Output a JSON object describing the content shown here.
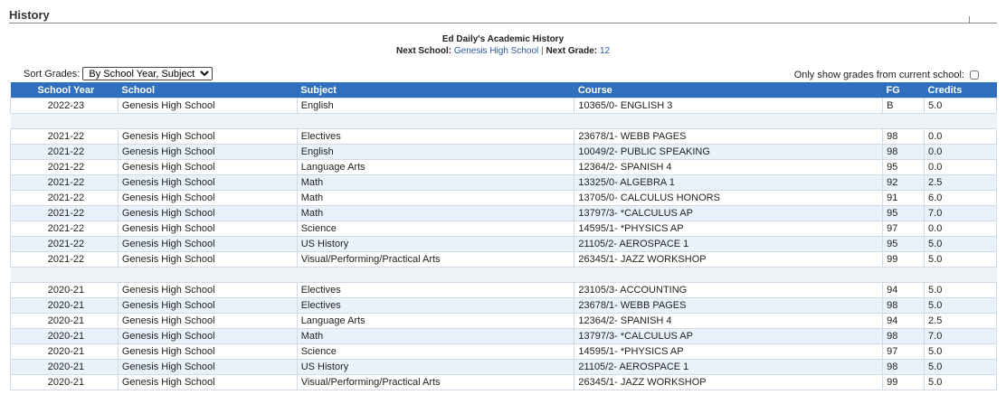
{
  "section": {
    "title": "History"
  },
  "header": {
    "student_history": "Ed Daily's Academic History",
    "next_school_label": "Next School:",
    "next_school_value": "Genesis High School",
    "separator": "|",
    "next_grade_label": "Next Grade:",
    "next_grade_value": "12"
  },
  "controls": {
    "sort_label": "Sort Grades:",
    "sort_selected": "By School Year, Subject",
    "only_current_label": "Only show grades from current school:"
  },
  "table": {
    "headers": [
      "School Year",
      "School",
      "Subject",
      "Course",
      "FG",
      "Credits"
    ],
    "groups": [
      [
        [
          "2022-23",
          "Genesis High School",
          "English",
          "10365/0- ENGLISH 3",
          "B",
          "5.0"
        ]
      ],
      [
        [
          "2021-22",
          "Genesis High School",
          "Electives",
          "23678/1- WEBB PAGES",
          "98",
          "0.0"
        ],
        [
          "2021-22",
          "Genesis High School",
          "English",
          "10049/2- PUBLIC SPEAKING",
          "98",
          "0.0"
        ],
        [
          "2021-22",
          "Genesis High School",
          "Language Arts",
          "12364/2- SPANISH 4",
          "95",
          "0.0"
        ],
        [
          "2021-22",
          "Genesis High School",
          "Math",
          "13325/0- ALGEBRA 1",
          "92",
          "2.5"
        ],
        [
          "2021-22",
          "Genesis High School",
          "Math",
          "13705/0- CALCULUS HONORS",
          "91",
          "6.0"
        ],
        [
          "2021-22",
          "Genesis High School",
          "Math",
          "13797/3- *CALCULUS AP",
          "95",
          "7.0"
        ],
        [
          "2021-22",
          "Genesis High School",
          "Science",
          "14595/1- *PHYSICS AP",
          "97",
          "0.0"
        ],
        [
          "2021-22",
          "Genesis High School",
          "US History",
          "21105/2- AEROSPACE 1",
          "95",
          "5.0"
        ],
        [
          "2021-22",
          "Genesis High School",
          "Visual/Performing/Practical Arts",
          "26345/1- JAZZ WORKSHOP",
          "99",
          "5.0"
        ]
      ],
      [
        [
          "2020-21",
          "Genesis High School",
          "Electives",
          "23105/3- ACCOUNTING",
          "94",
          "5.0"
        ],
        [
          "2020-21",
          "Genesis High School",
          "Electives",
          "23678/1- WEBB PAGES",
          "98",
          "5.0"
        ],
        [
          "2020-21",
          "Genesis High School",
          "Language Arts",
          "12364/2- SPANISH 4",
          "94",
          "2.5"
        ],
        [
          "2020-21",
          "Genesis High School",
          "Math",
          "13797/3- *CALCULUS AP",
          "98",
          "7.0"
        ],
        [
          "2020-21",
          "Genesis High School",
          "Science",
          "14595/1- *PHYSICS AP",
          "97",
          "5.0"
        ],
        [
          "2020-21",
          "Genesis High School",
          "US History",
          "21105/2- AEROSPACE 1",
          "98",
          "5.0"
        ],
        [
          "2020-21",
          "Genesis High School",
          "Visual/Performing/Practical Arts",
          "26345/1- JAZZ WORKSHOP",
          "99",
          "5.0"
        ]
      ]
    ]
  }
}
